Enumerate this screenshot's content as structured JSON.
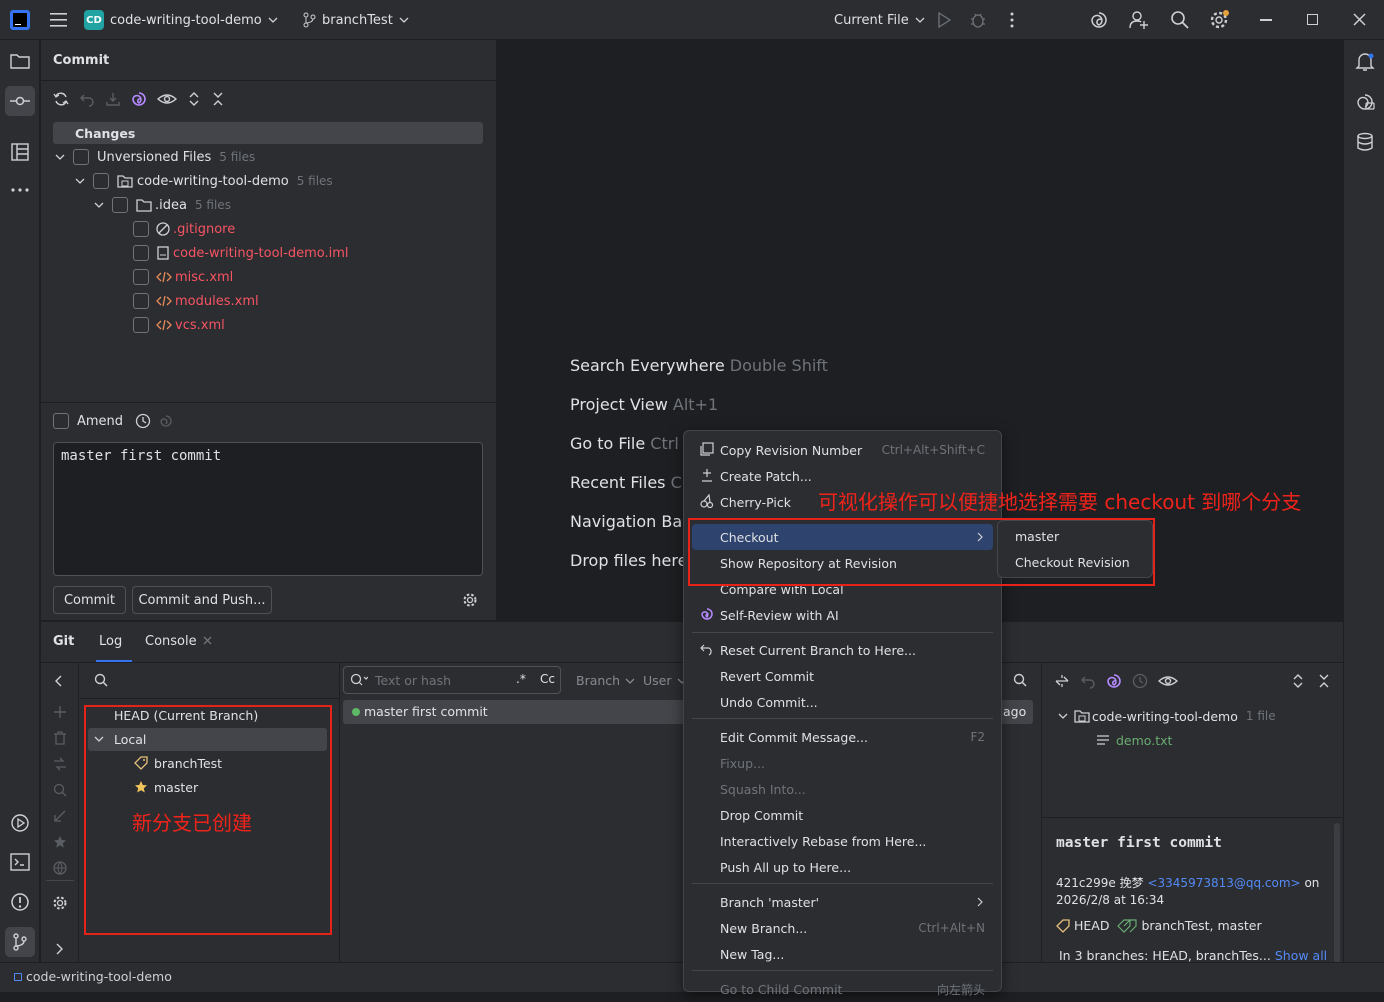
{
  "titlebar": {
    "project_badge": "CD",
    "project_name": "code-writing-tool-demo",
    "branch": "branchTest",
    "run_config": "Current File"
  },
  "commit_panel": {
    "title": "Commit",
    "changes_header": "Changes",
    "tree": [
      {
        "label": "Unversioned Files",
        "count": "5 files"
      },
      {
        "label": "code-writing-tool-demo",
        "count": "5 files"
      },
      {
        "label": ".idea",
        "count": "5 files"
      },
      {
        "label": ".gitignore"
      },
      {
        "label": "code-writing-tool-demo.iml"
      },
      {
        "label": "misc.xml"
      },
      {
        "label": "modules.xml"
      },
      {
        "label": "vcs.xml"
      }
    ],
    "amend_label": "Amend",
    "message": "master first commit",
    "commit_btn": "Commit",
    "commit_push_btn": "Commit and Push..."
  },
  "editor_hints": [
    {
      "label": "Search Everywhere",
      "shortcut": "Double Shift"
    },
    {
      "label": "Project View",
      "shortcut": "Alt+1"
    },
    {
      "label": "Go to File",
      "shortcut": "Ctrl"
    },
    {
      "label": "Recent Files",
      "shortcut": "C"
    },
    {
      "label": "Navigation Bar",
      "shortcut": ""
    },
    {
      "label": "Drop files here",
      "shortcut": ""
    }
  ],
  "git_panel": {
    "tabs": [
      "Git",
      "Log",
      "Console"
    ],
    "branches": {
      "head": "HEAD (Current Branch)",
      "local": "Local",
      "items": [
        "branchTest",
        "master"
      ]
    },
    "filter": {
      "placeholder": "Text or hash",
      "regex": ".*",
      "case": "Cc",
      "branch": "Branch",
      "user": "User"
    },
    "commit_row": {
      "message": "master first commit",
      "time": "ago"
    },
    "changed_tree": {
      "root": "code-writing-tool-demo",
      "count": "1 file",
      "file": "demo.txt"
    },
    "details": {
      "title": "master first commit",
      "hash": "421c299e",
      "author": "挽梦",
      "email": "<3345973813@qq.com>",
      "on": "on",
      "date": "2026/2/8 at 16:34",
      "head": "HEAD",
      "refs": "branchTest, master",
      "branches_text": "In 3 branches: HEAD, branchTes...",
      "show_all": "Show all"
    }
  },
  "context_menu": {
    "items": [
      {
        "label": "Copy Revision Number",
        "shortcut": "Ctrl+Alt+Shift+C"
      },
      {
        "label": "Create Patch..."
      },
      {
        "label": "Cherry-Pick"
      },
      {
        "label": "Checkout"
      },
      {
        "label": "Show Repository at Revision"
      },
      {
        "label": "Compare with Local"
      },
      {
        "label": "Self-Review with AI"
      },
      {
        "label": "Reset Current Branch to Here..."
      },
      {
        "label": "Revert Commit"
      },
      {
        "label": "Undo Commit..."
      },
      {
        "label": "Edit Commit Message...",
        "shortcut": "F2"
      },
      {
        "label": "Fixup..."
      },
      {
        "label": "Squash Into..."
      },
      {
        "label": "Drop Commit"
      },
      {
        "label": "Interactively Rebase from Here..."
      },
      {
        "label": "Push All up to Here..."
      },
      {
        "label": "Branch 'master'"
      },
      {
        "label": "New Branch...",
        "shortcut": "Ctrl+Alt+N"
      },
      {
        "label": "New Tag..."
      },
      {
        "label": "Go to Child Commit",
        "shortcut": "向左箭头"
      }
    ],
    "submenu": [
      "master",
      "Checkout Revision"
    ]
  },
  "annotations": {
    "checkout_note": "可视化操作可以便捷地选择需要 checkout 到哪个分支",
    "branch_note": "新分支已创建"
  },
  "statusbar": {
    "project": "code-writing-tool-demo"
  }
}
